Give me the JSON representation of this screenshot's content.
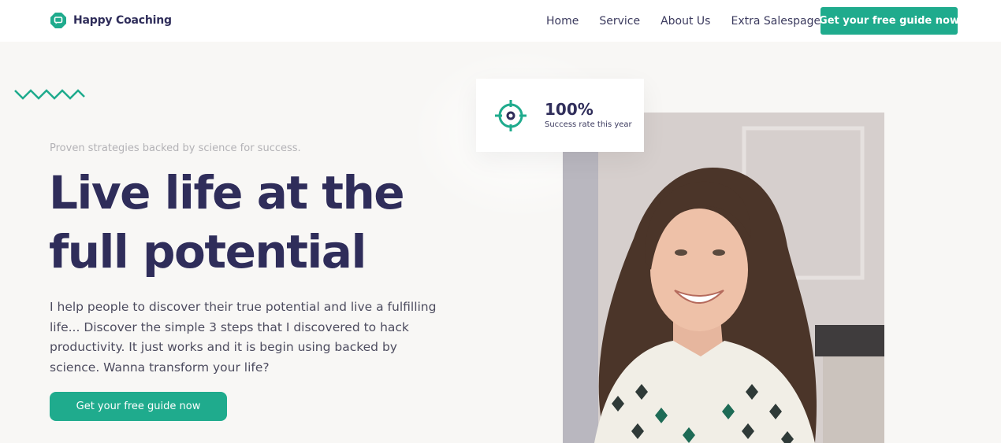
{
  "header": {
    "brand_name": "Happy Coaching",
    "nav": [
      "Home",
      "Service",
      "About Us",
      "Extra Salespage"
    ],
    "cta_label": "Get your free guide now"
  },
  "hero": {
    "eyebrow": "Proven strategies backed by science for success.",
    "headline_line1": "Live life at the",
    "headline_line2": "full potential",
    "lead": "I help people to discover their true potential and live a fulfilling life... Discover the simple 3 steps that I discovered to hack productivity. It just works and it is begin using backed by science. Wanna transform your life?",
    "cta_label": "Get your free guide now"
  },
  "stat_card": {
    "value": "100%",
    "label": "Success rate this year",
    "icon": "target-icon"
  },
  "colors": {
    "accent": "#1fab8d",
    "heading": "#2f2d5a",
    "background": "#f8f7f5"
  }
}
